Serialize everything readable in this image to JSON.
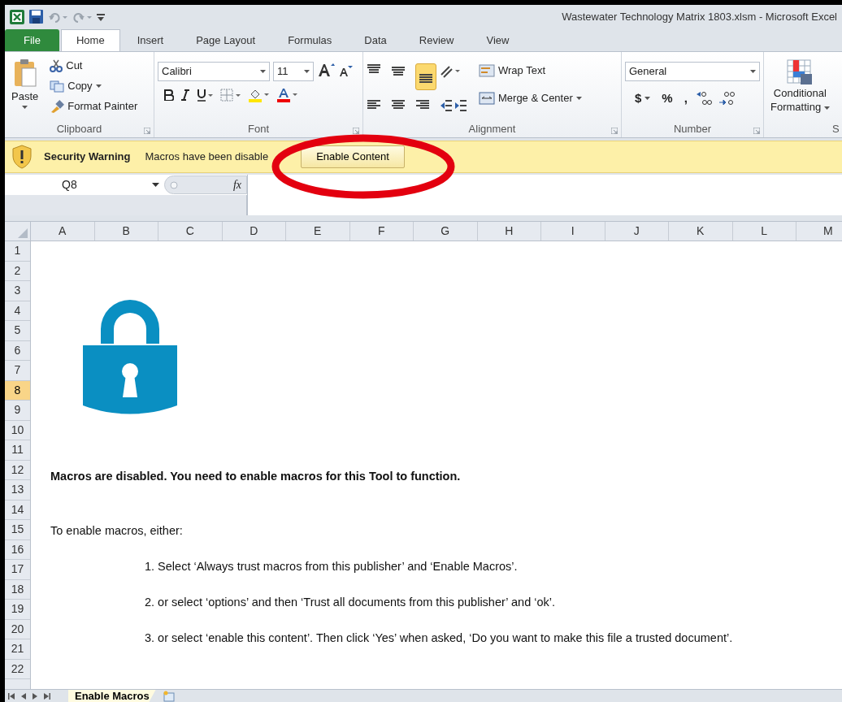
{
  "window": {
    "title": "Wastewater Technology Matrix 1803.xlsm  -  Microsoft Excel"
  },
  "tabs": [
    {
      "label": "File",
      "kind": "file",
      "selected": false
    },
    {
      "label": "Home",
      "kind": "tab",
      "selected": true
    },
    {
      "label": "Insert",
      "kind": "tab",
      "selected": false
    },
    {
      "label": "Page Layout",
      "kind": "tab",
      "selected": false
    },
    {
      "label": "Formulas",
      "kind": "tab",
      "selected": false
    },
    {
      "label": "Data",
      "kind": "tab",
      "selected": false
    },
    {
      "label": "Review",
      "kind": "tab",
      "selected": false
    },
    {
      "label": "View",
      "kind": "tab",
      "selected": false
    }
  ],
  "ribbon": {
    "clipboard": {
      "label": "Clipboard",
      "paste": "Paste",
      "cut": "Cut",
      "copy": "Copy",
      "format_painter": "Format Painter"
    },
    "font": {
      "label": "Font",
      "font_name": "Calibri",
      "font_size": "11"
    },
    "alignment": {
      "label": "Alignment",
      "wrap_text": "Wrap Text",
      "merge_center": "Merge & Center",
      "bottom_align_selected": true
    },
    "number": {
      "label": "Number",
      "format": "General",
      "currency": "$",
      "percent": "%",
      "comma": ","
    },
    "styles": {
      "label": "S",
      "conditional_formatting": [
        "Conditional",
        "Formatting"
      ]
    }
  },
  "security_warning": {
    "title": "Security Warning",
    "message": "Macros have been disable",
    "button": "Enable Content"
  },
  "formula_bar": {
    "name_box": "Q8",
    "function_label": "fx"
  },
  "columns": [
    "A",
    "B",
    "C",
    "D",
    "E",
    "F",
    "G",
    "H",
    "I",
    "J",
    "K",
    "L",
    "M"
  ],
  "rows": [
    {
      "label": "1",
      "selected": false
    },
    {
      "label": "2",
      "selected": false
    },
    {
      "label": "3",
      "selected": false
    },
    {
      "label": "4",
      "selected": false
    },
    {
      "label": "5",
      "selected": false
    },
    {
      "label": "6",
      "selected": false
    },
    {
      "label": "7",
      "selected": false
    },
    {
      "label": "8",
      "selected": true
    },
    {
      "label": "9",
      "selected": false
    },
    {
      "label": "10",
      "selected": false
    },
    {
      "label": "11",
      "selected": false
    },
    {
      "label": "12",
      "selected": false
    },
    {
      "label": "13",
      "selected": false
    },
    {
      "label": "14",
      "selected": false
    },
    {
      "label": "15",
      "selected": false
    },
    {
      "label": "16",
      "selected": false
    },
    {
      "label": "17",
      "selected": false
    },
    {
      "label": "18",
      "selected": false
    },
    {
      "label": "19",
      "selected": false
    },
    {
      "label": "20",
      "selected": false
    },
    {
      "label": "21",
      "selected": false
    },
    {
      "label": "22",
      "selected": false
    }
  ],
  "sheet_content": {
    "heading": "Macros are disabled. You need to enable macros for this Tool to function.",
    "intro": "To enable macros, either:",
    "steps": [
      "1. Select ‘Always trust macros from this publisher’ and ‘Enable Macros’.",
      "2. or select ‘options’ and then ‘Trust all documents from this publisher’ and ‘ok’.",
      "3. or select ‘enable this content’. Then click ‘Yes’ when asked, ‘Do you want to make this file a trusted document’."
    ]
  },
  "sheet_tabs": [
    {
      "label": "Enable Macros",
      "selected": true
    }
  ]
}
